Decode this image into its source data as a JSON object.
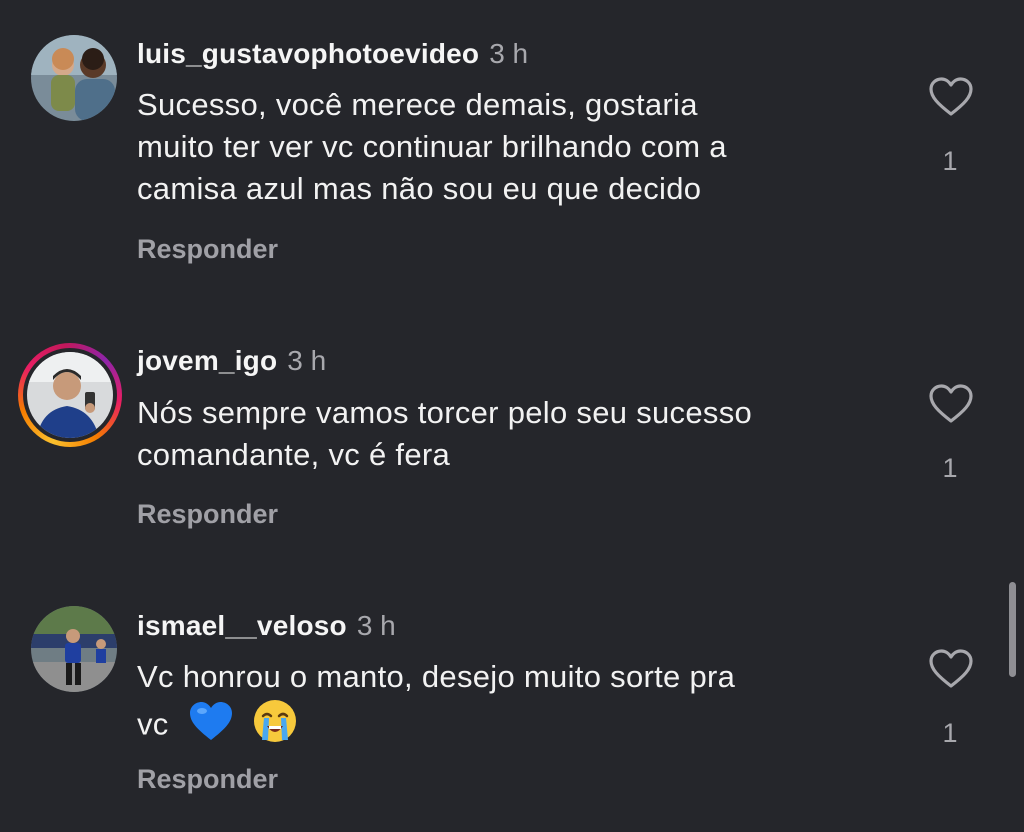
{
  "comments": [
    {
      "username": "luis_gustavophotoevideo",
      "time": "3 h",
      "lines": [
        "Sucesso, você merece demais, gostaria",
        "muito ter ver vc continuar brilhando com a",
        "camisa azul mas não sou eu que decido"
      ],
      "reply_label": "Responder",
      "likes": "1",
      "like_icon": "heart-outline-icon",
      "story_ring": false
    },
    {
      "username": "jovem_igo",
      "time": "3 h",
      "lines": [
        "Nós sempre vamos torcer pelo seu sucesso",
        "comandante, vc é fera"
      ],
      "reply_label": "Responder",
      "likes": "1",
      "like_icon": "heart-outline-icon",
      "story_ring": true
    },
    {
      "username": "ismael__veloso",
      "time": "3 h",
      "lines": [
        "Vc honrou o manto, desejo muito sorte pra",
        "vc"
      ],
      "emojis": [
        "blue-heart-emoji",
        "loudly-crying-face-emoji"
      ],
      "reply_label": "Responder",
      "likes": "1",
      "like_icon": "heart-outline-icon",
      "story_ring": false
    }
  ],
  "colors": {
    "background": "#25262b",
    "text": "#f2f2f2",
    "muted": "#a8a8ad",
    "story_ring_gradient": [
      "#fbc02d",
      "#e91e63",
      "#8e24aa"
    ]
  }
}
